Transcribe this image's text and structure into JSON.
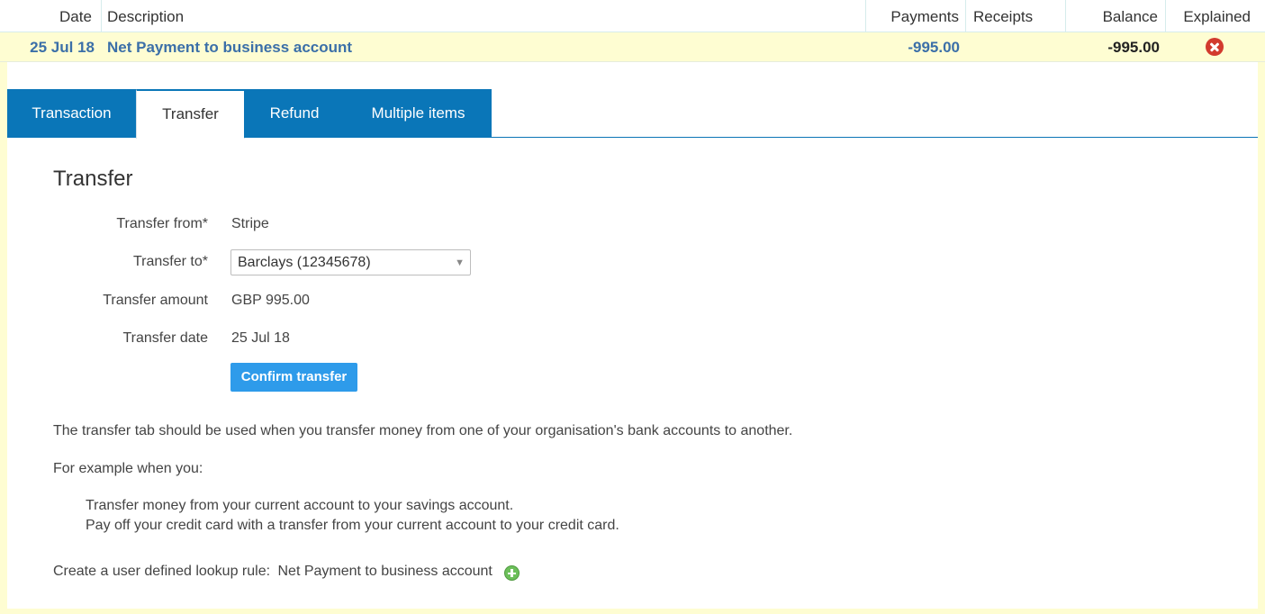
{
  "columns": {
    "date": "Date",
    "description": "Description",
    "payments": "Payments",
    "receipts": "Receipts",
    "balance": "Balance",
    "explained": "Explained"
  },
  "row": {
    "date": "25 Jul 18",
    "description": "Net Payment to business account",
    "payments": "-995.00",
    "receipts": "",
    "balance": "-995.00",
    "explained_icon": "remove-circle-icon"
  },
  "tabs": [
    {
      "label": "Transaction",
      "active": false
    },
    {
      "label": "Transfer",
      "active": true
    },
    {
      "label": "Refund",
      "active": false
    },
    {
      "label": "Multiple items",
      "active": false
    }
  ],
  "form": {
    "title": "Transfer",
    "from_label": "Transfer from*",
    "from_value": "Stripe",
    "to_label": "Transfer to*",
    "to_value": "Barclays (12345678)",
    "amount_label": "Transfer amount",
    "amount_value": "GBP 995.00",
    "date_label": "Transfer date",
    "date_value": "25 Jul 18",
    "confirm_label": "Confirm transfer"
  },
  "help": {
    "intro": "The transfer tab should be used when you transfer money from one of your organisation's bank accounts to another.",
    "example_heading": "For example when you:",
    "examples": [
      "Transfer money from your current account to your savings account.",
      "Pay off your credit card with a transfer from your current account to your credit card."
    ],
    "lookup_rule_label": "Create a user defined lookup rule:",
    "lookup_rule_value": "Net Payment to business account",
    "lookup_rule_icon": "add-circle-icon"
  },
  "colors": {
    "row_highlight": "#fefdd2",
    "tab_blue": "#0a76b8",
    "button_blue": "#2e9bea",
    "link_blue": "#3b6fa8",
    "error_red": "#d23a2e",
    "add_green": "#6cbf5a"
  }
}
